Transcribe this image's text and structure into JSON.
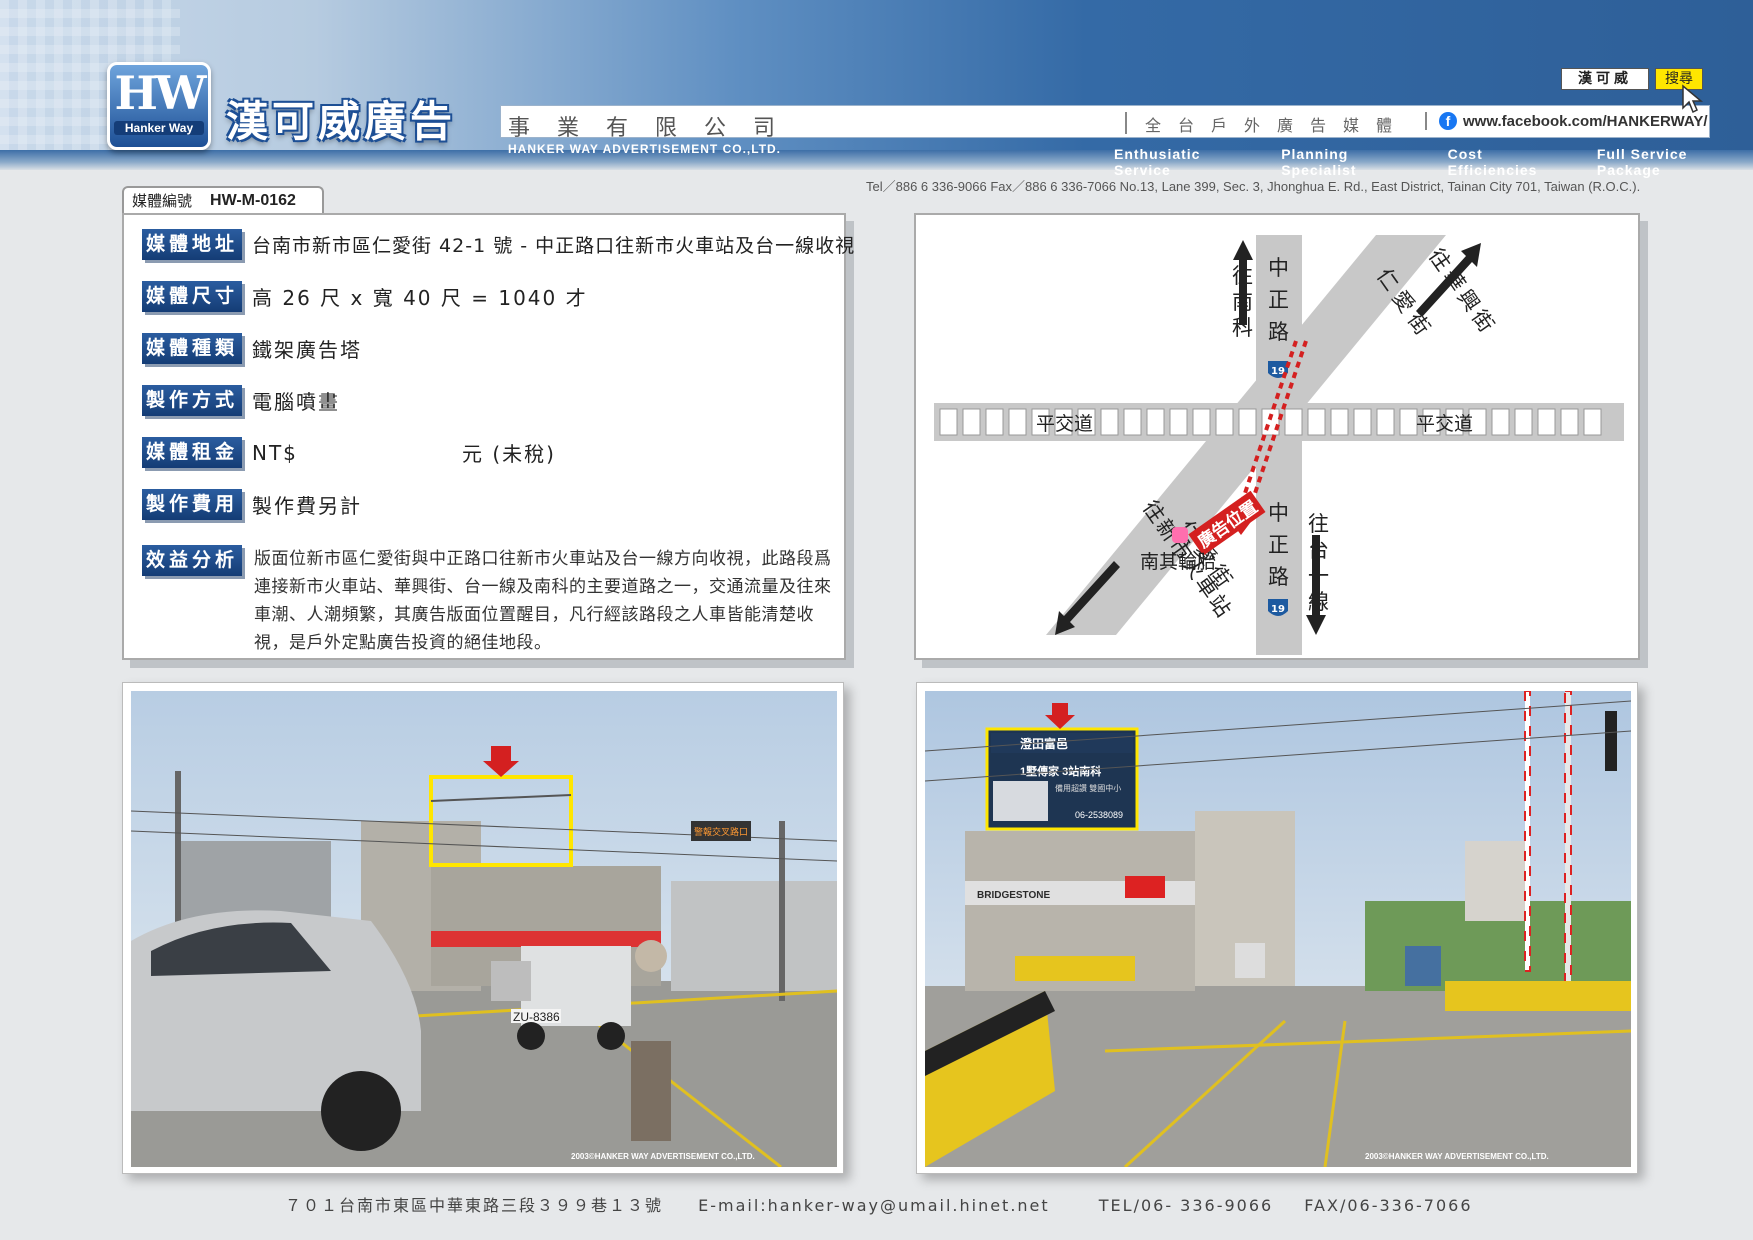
{
  "header": {
    "logo_text": "HW",
    "logo_sub": "Hanker Way",
    "company_cn": "漢可威廣告",
    "company_suffix": "事業有限公司",
    "company_en": "HANKER WAY ADVERTISEMENT CO.,LTD.",
    "tagline": "全台戶外廣告媒體",
    "facebook": "www.facebook.com/HANKERWAY/",
    "search_value": "漢可威",
    "search_button": "搜尋",
    "slogans": [
      "Enthusiatic Service",
      "Planning Specialist",
      "Cost Efficiencies",
      "Full Service Package"
    ],
    "contact": "Tel／886 6 336-9066   Fax／886 6 336-7066   No.13, Lane 399, Sec. 3, Jhonghua E. Rd., East District, Tainan City 701, Taiwan (R.O.C.)."
  },
  "media": {
    "id_label": "媒體編號",
    "id_value": "HW-M-0162",
    "rows": [
      {
        "label": "媒體地址",
        "value": "台南市新市區仁愛街 42-1 號 - 中正路口往新市火車站及台一線收視"
      },
      {
        "label": "媒體尺寸",
        "value": "高 26 尺 x 寬 40 尺 = 1040 才"
      },
      {
        "label": "媒體種類",
        "value": "鐵架廣告塔"
      },
      {
        "label": "製作方式",
        "value": "電腦噴畫"
      },
      {
        "label": "媒體租金",
        "value": "NT$",
        "value_suffix": "元 (未稅)"
      },
      {
        "label": "製作費用",
        "value": "製作費另計"
      },
      {
        "label": "效益分析",
        "value": "版面位新市區仁愛街與中正路口往新市火車站及台一線方向收視，此路段爲連接新市火車站、華興街、台一線及南科的主要道路之一，交通流量及往來車潮、人潮頻繁，其廣告版面位置醒目，凡行經該路段之人車皆能清楚收視，是戶外定點廣告投資的絕佳地段。"
      }
    ]
  },
  "map": {
    "road_zhongzheng_top": "中正路",
    "road_zhongzheng_bottom": "中正路",
    "road_renai_top": "仁愛街",
    "road_renai_bottom": "仁愛街",
    "dir_nanke": "往南科",
    "dir_huaxing": "往華興街",
    "dir_tai1": "往台一線",
    "dir_station": "往新市火車站",
    "crossing_left": "平交道",
    "crossing_right": "平交道",
    "ad_position": "廣告位置",
    "landmark": "南其輪胎",
    "route_number": "19"
  },
  "photos": {
    "left_plate": "ZU-8386",
    "left_sign": "警報交叉路口",
    "right_billboard_brand": "澄田富邑",
    "right_billboard_headline": "1墅傳家 3站南科",
    "right_billboard_sub": "備用超讚  雙國中小",
    "right_billboard_phone": "06-2538089",
    "right_shop_sign": "BRIDGESTONE",
    "copyright": "2003©HANKER WAY ADVERTISEMENT CO.,LTD."
  },
  "footer": {
    "address": "７０１台南市東區中華東路三段３９９巷１３號",
    "email": "E-mail:hanker-way@umail.hinet.net",
    "tel": "TEL/06- 336-9066",
    "fax": "FAX/06-336-7066"
  },
  "colors": {
    "label_blue": "#1d4a8a",
    "ad_red": "#d42020",
    "highlight_yellow": "#ffe600",
    "road_gray": "#c8c8c8"
  }
}
